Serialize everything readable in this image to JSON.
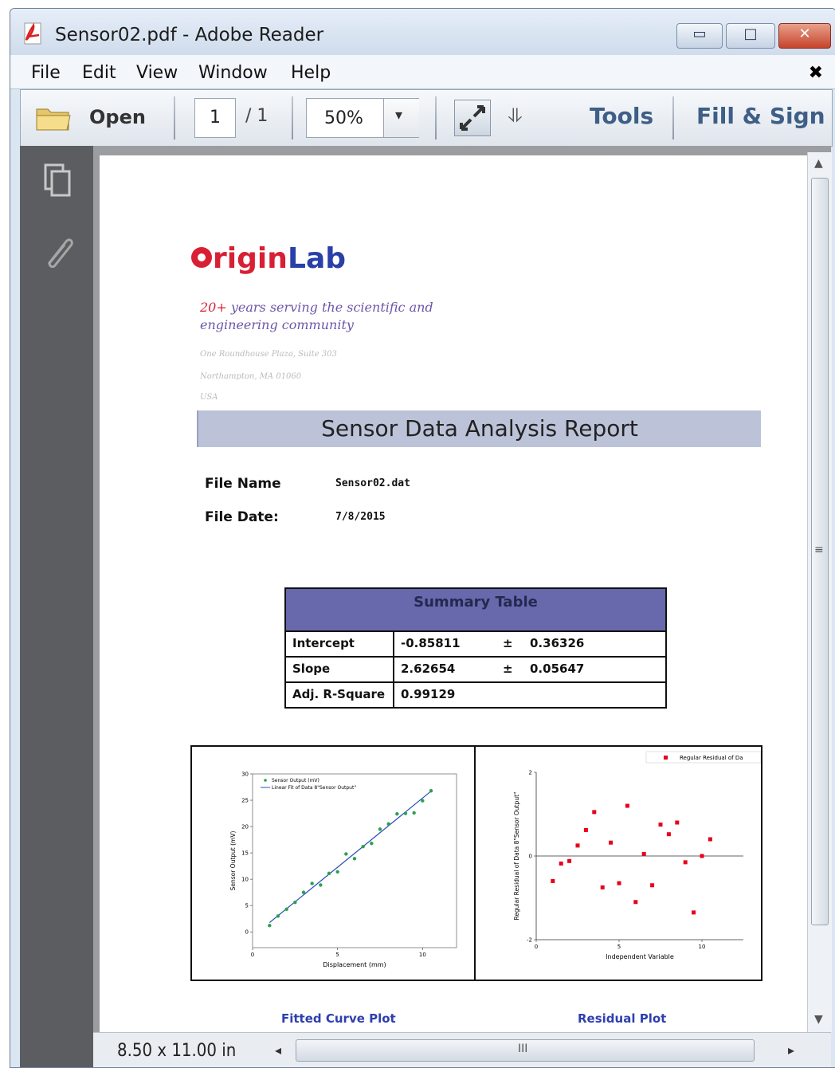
{
  "window": {
    "title": "Sensor02.pdf - Adobe Reader"
  },
  "window_controls": {
    "minimize": "▭",
    "maximize": "□",
    "close": "✕"
  },
  "menu": {
    "file": "File",
    "edit": "Edit",
    "view": "View",
    "window": "Window",
    "help": "Help",
    "close_doc": "✖"
  },
  "toolbar": {
    "open_label": "Open",
    "page_current": "1",
    "page_total": "/ 1",
    "zoom": "50%",
    "zoom_dropdown": "▾",
    "more": "⥥",
    "tools_label": "Tools",
    "fill_sign_label": "Fill & Sign"
  },
  "statusbar": {
    "page_size": "8.50 x 11.00 in",
    "scroll_left": "◂",
    "scroll_right": "▸",
    "grip": "III"
  },
  "scrollbar": {
    "up": "▲",
    "down": "▼",
    "grip": "≡"
  },
  "colors": {
    "accent": "#3e5f86",
    "banner": "#bcc3d9",
    "summary_header": "#6868ad",
    "marker_fit": "#2ca04c",
    "marker_residual": "#e8001c",
    "caption": "#2f3fae"
  },
  "icons": {
    "app": "pdf-icon",
    "open": "folder-icon",
    "fit": "expand-icon",
    "pages": "pages-icon",
    "attachments": "paperclip-icon"
  },
  "report": {
    "logo_text": "OriginLab",
    "tagline_num": "20+",
    "tagline_rest": " years serving the scientific and engineering community",
    "address": [
      "One Roundhouse Plaza, Suite 303",
      "Northampton, MA 01060",
      "USA"
    ],
    "title": "Sensor Data Analysis Report",
    "fields": [
      {
        "label": "File Name",
        "value": "Sensor02.dat"
      },
      {
        "label": "File Date:",
        "value": "7/8/2015"
      }
    ],
    "summary": {
      "title": "Summary Table",
      "rows": [
        {
          "name": "Intercept",
          "value": "-0.85811",
          "pm": "±",
          "err": "0.36326"
        },
        {
          "name": "Slope",
          "value": "2.62654",
          "pm": "±",
          "err": "0.05647"
        },
        {
          "name": "Adj. R-Square",
          "value": "0.99129",
          "pm": "",
          "err": ""
        }
      ]
    },
    "captions": {
      "fit": "Fitted Curve Plot",
      "residual": "Residual Plot"
    }
  },
  "chart_data": [
    {
      "type": "scatter",
      "xlabel": "Displacement (mm)",
      "ylabel": "Sensor Output (mV)",
      "xlim": [
        0,
        12
      ],
      "ylim": [
        -3,
        30
      ],
      "xticks": [
        0,
        5,
        10
      ],
      "yticks": [
        0,
        5,
        10,
        15,
        20,
        25,
        30
      ],
      "legend": [
        "Sensor Output (mV)",
        "Linear Fit of Data 8\"Sensor Output\""
      ],
      "legend_position": "top-left",
      "series": [
        {
          "name": "Sensor Output (mV)",
          "x": [
            1,
            1.5,
            2,
            2.5,
            3,
            3.5,
            4,
            4.5,
            5,
            5.5,
            6,
            6.5,
            7,
            7.5,
            8,
            8.5,
            9,
            9.5,
            10,
            10.5
          ],
          "y": [
            1.2,
            3.0,
            4.3,
            5.6,
            7.5,
            9.2,
            8.9,
            11.1,
            11.4,
            14.8,
            13.9,
            16.2,
            16.8,
            19.5,
            20.5,
            22.4,
            22.5,
            22.6,
            24.9,
            26.8
          ]
        },
        {
          "name": "Linear Fit of Data 8\"Sensor Output\"",
          "x": [
            1,
            10.5
          ],
          "y": [
            1.77,
            26.72
          ]
        }
      ]
    },
    {
      "type": "scatter",
      "xlabel": "Independent Variable",
      "ylabel": "Regular Residual of Data 8\"Sensor Output\"",
      "xlim": [
        0,
        12.5
      ],
      "ylim": [
        -2,
        2
      ],
      "xticks": [
        0,
        5,
        10
      ],
      "yticks": [
        -2,
        0,
        2
      ],
      "legend": [
        "Regular Residual of Da"
      ],
      "legend_position": "top-right",
      "series": [
        {
          "name": "Regular Residual of Da",
          "x": [
            1,
            1.5,
            2,
            2.5,
            3,
            3.5,
            4,
            4.5,
            5,
            5.5,
            6,
            6.5,
            7,
            7.5,
            8,
            8.5,
            9,
            9.5,
            10,
            10.5
          ],
          "y": [
            -0.6,
            -0.18,
            -0.12,
            0.25,
            0.62,
            1.05,
            -0.75,
            0.32,
            -0.65,
            1.2,
            -1.1,
            0.05,
            -0.7,
            0.75,
            0.52,
            0.8,
            -0.15,
            -1.35,
            0.0,
            0.4
          ]
        }
      ]
    }
  ]
}
